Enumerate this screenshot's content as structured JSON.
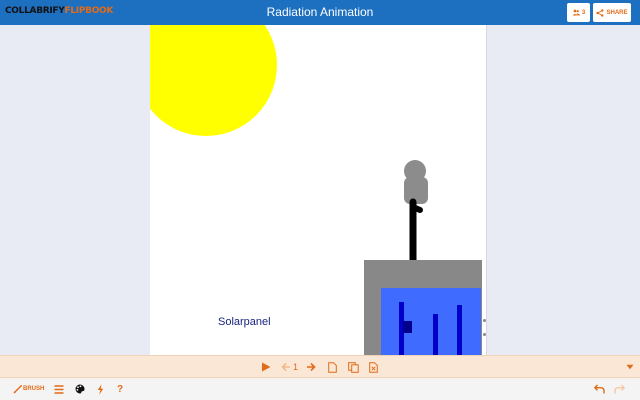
{
  "header": {
    "logo_part1": "COLLABRIFY",
    "logo_part2": "FLIPBOOK",
    "title": "Radiation Animation",
    "users_count": "3",
    "share_label": "SHARE"
  },
  "canvas": {
    "label": "Solarpanel"
  },
  "playbar": {
    "page_number": "1"
  },
  "toolbar": {
    "brush_label": "BRUSH",
    "help_label": "?"
  },
  "colors": {
    "header_bg": "#1d6fc0",
    "accent": "#e26b17",
    "sun": "#ffff00",
    "panel_frame": "#888888",
    "panel_glass": "#3f6bff",
    "panel_stripes": "#0000c8",
    "figure": "#8c8c8c"
  },
  "icons": {
    "users": "users-icon",
    "share": "share-icon",
    "play": "play-icon",
    "prev": "arrow-left-icon",
    "next": "arrow-right-icon",
    "new_page": "new-page-icon",
    "copy_page": "copy-page-icon",
    "delete_page": "delete-page-icon",
    "expand": "chevron-down-icon",
    "brush": "brush-icon",
    "layers": "menu-icon",
    "palette": "palette-icon",
    "effects": "lightning-icon",
    "undo": "undo-icon",
    "redo": "redo-icon"
  }
}
